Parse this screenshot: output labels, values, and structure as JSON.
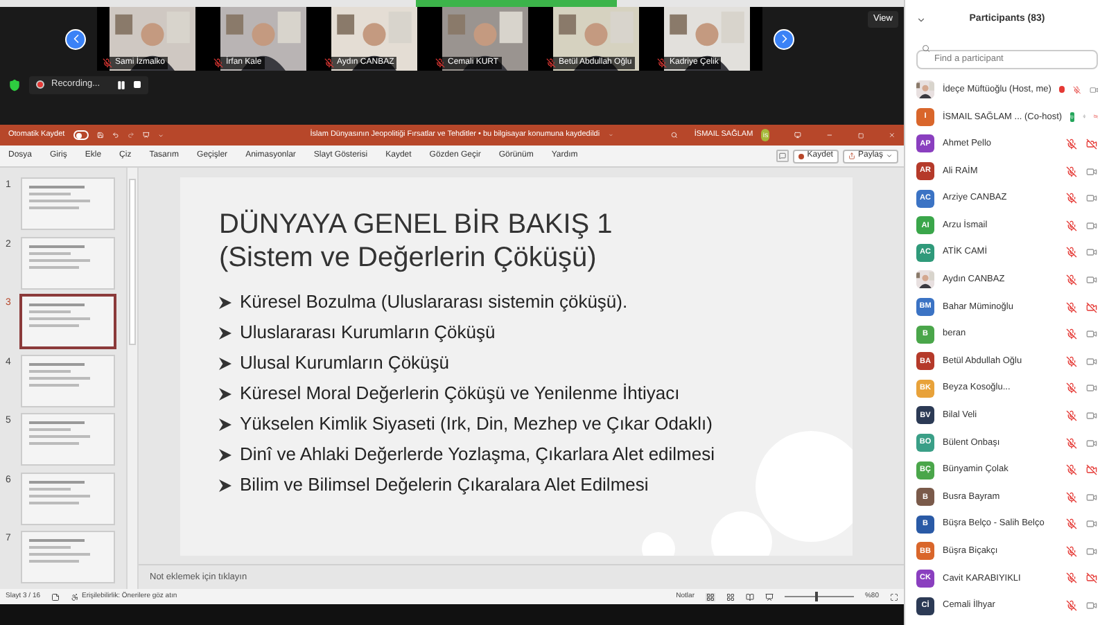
{
  "video_strip": {
    "tiles": [
      {
        "name": "Sami İzmalko",
        "muted": true
      },
      {
        "name": "İrfan Kale",
        "muted": true
      },
      {
        "name": "Aydın CANBAZ",
        "muted": true
      },
      {
        "name": "Cemali KURT",
        "muted": true
      },
      {
        "name": "Betül Abdullah Oğlu",
        "muted": true
      },
      {
        "name": "Kadriye Çelik",
        "muted": true
      }
    ],
    "view_button": "View"
  },
  "recording": {
    "label": "Recording..."
  },
  "powerpoint": {
    "autosave": {
      "label": "Otomatik Kaydet",
      "on": false
    },
    "title": "İslam Dünyasının Jeopolitiği Fırsatlar ve Tehditler • bu bilgisayar konumuna kaydedildi",
    "user": {
      "name": "İSMAIL SAĞLAM",
      "initials": "İS"
    },
    "menu": [
      "Dosya",
      "Giriş",
      "Ekle",
      "Çiz",
      "Tasarım",
      "Geçişler",
      "Animasyonlar",
      "Slayt Gösterisi",
      "Kaydet",
      "Gözden Geçir",
      "Görünüm",
      "Yardım"
    ],
    "save_button": "Kaydet",
    "share_button": "Paylaş",
    "thumbnails": [
      {
        "number": "1",
        "selected": false
      },
      {
        "number": "2",
        "selected": false
      },
      {
        "number": "3",
        "selected": true
      },
      {
        "number": "4",
        "selected": false
      },
      {
        "number": "5",
        "selected": false
      },
      {
        "number": "6",
        "selected": false
      },
      {
        "number": "7",
        "selected": false
      }
    ],
    "slide": {
      "title": [
        "DÜNYAYA GENEL BİR BAKIŞ 1",
        "(Sistem ve Değerlerin Çöküşü)"
      ],
      "bullets": [
        "Küresel Bozulma (Uluslararası sistemin çöküşü).",
        "Uluslararası Kurumların Çöküşü",
        "Ulusal Kurumların Çöküşü",
        "Küresel Moral Değerlerin Çöküşü ve Yenilenme İhtiyacı",
        "Yükselen Kimlik Siyaseti (Irk, Din, Mezhep ve Çıkar Odaklı)",
        "Dinî ve Ahlaki Değerlerde Yozlaşma, Çıkarlara Alet edilmesi",
        "Bilim ve Bilimsel Değelerin Çıkaralara Alet Edilmesi"
      ]
    },
    "notes_placeholder": "Not eklemek için tıklayın",
    "status": {
      "slide_counter": "Slayt 3 / 16",
      "accessibility": "Erişilebilirlik: Önerilere göz atın",
      "notes_button": "Notlar",
      "zoom": {
        "level": 0.45,
        "reading": "%80"
      }
    }
  },
  "participants": {
    "title": "Participants (83)",
    "search": {
      "placeholder": "Find a participant"
    },
    "items": [
      {
        "name": "İdeçe Müftüoğlu (Host, me)",
        "recording": true,
        "sharing": false,
        "muted": true,
        "video_on": true
      },
      {
        "name": "İSMAIL SAĞLAM ... (Co-host)",
        "kind": "initials",
        "initials": "I",
        "color": "#d9662b",
        "recording": false,
        "sharing": true,
        "muted": false,
        "video_on": false
      },
      {
        "name": "Ahmet Pello",
        "kind": "initials",
        "initials": "AP",
        "color": "#8a3fbf",
        "recording": false,
        "sharing": false,
        "muted": true,
        "video_on": false
      },
      {
        "name": "Ali RAİM",
        "kind": "initials",
        "initials": "AR",
        "color": "#b53a2a",
        "recording": false,
        "sharing": false,
        "muted": true,
        "video_on": true
      },
      {
        "name": "Arziye CANBAZ",
        "kind": "initials",
        "initials": "AC",
        "color": "#3b73c4",
        "recording": false,
        "sharing": false,
        "muted": true,
        "video_on": true
      },
      {
        "name": "Arzu İsmail",
        "kind": "initials",
        "initials": "AI",
        "color": "#3aa64a",
        "recording": false,
        "sharing": false,
        "muted": true,
        "video_on": true
      },
      {
        "name": "ATİK CAMİ",
        "kind": "initials",
        "initials": "AC",
        "color": "#2f9a7a",
        "recording": false,
        "sharing": false,
        "muted": true,
        "video_on": true
      },
      {
        "name": "Aydın CANBAZ",
        "recording": false,
        "sharing": false,
        "muted": true,
        "video_on": true
      },
      {
        "name": "Bahar Müminoğlu",
        "kind": "initials",
        "initials": "BM",
        "color": "#3b73c4",
        "recording": false,
        "sharing": false,
        "muted": true,
        "video_on": false
      },
      {
        "name": "beran",
        "kind": "initials",
        "initials": "B",
        "color": "#4aa64a",
        "recording": false,
        "sharing": false,
        "muted": true,
        "video_on": true
      },
      {
        "name": "Betül Abdullah Oğlu",
        "kind": "initials",
        "initials": "BA",
        "color": "#b53a2a",
        "recording": false,
        "sharing": false,
        "muted": true,
        "video_on": true
      },
      {
        "name": "Beyza Kosoğlu...",
        "kind": "initials",
        "initials": "BK",
        "color": "#e8a23a",
        "recording": false,
        "sharing": false,
        "muted": true,
        "video_on": true
      },
      {
        "name": "Bilal Veli",
        "kind": "initials",
        "initials": "BV",
        "color": "#2c3a55",
        "recording": false,
        "sharing": false,
        "muted": true,
        "video_on": true
      },
      {
        "name": "Bülent Onbaşı",
        "kind": "initials",
        "initials": "BO",
        "color": "#3a9f87",
        "recording": false,
        "sharing": false,
        "muted": true,
        "video_on": true
      },
      {
        "name": "Bünyamin Çolak",
        "kind": "initials",
        "initials": "BÇ",
        "color": "#4aa64a",
        "recording": false,
        "sharing": false,
        "muted": true,
        "video_on": false
      },
      {
        "name": "Busra Bayram",
        "kind": "initials",
        "initials": "B",
        "color": "#7a5a4a",
        "recording": false,
        "sharing": false,
        "muted": true,
        "video_on": true
      },
      {
        "name": "Büşra Belço - Salih Belço",
        "kind": "initials",
        "initials": "B",
        "color": "#2a5aa6",
        "recording": false,
        "sharing": false,
        "muted": true,
        "video_on": true
      },
      {
        "name": "Büşra Biçakçı",
        "kind": "initials",
        "initials": "BB",
        "color": "#d9662b",
        "recording": false,
        "sharing": false,
        "muted": true,
        "video_on": true
      },
      {
        "name": "Cavit KARABIYIKLI",
        "kind": "initials",
        "initials": "CK",
        "color": "#8a3fbf",
        "recording": false,
        "sharing": false,
        "muted": true,
        "video_on": false
      },
      {
        "name": "Cemali İlhyar",
        "kind": "initials",
        "initials": "Cİ",
        "color": "#2c3a55",
        "recording": false,
        "sharing": false,
        "muted": true,
        "video_on": true
      }
    ]
  }
}
